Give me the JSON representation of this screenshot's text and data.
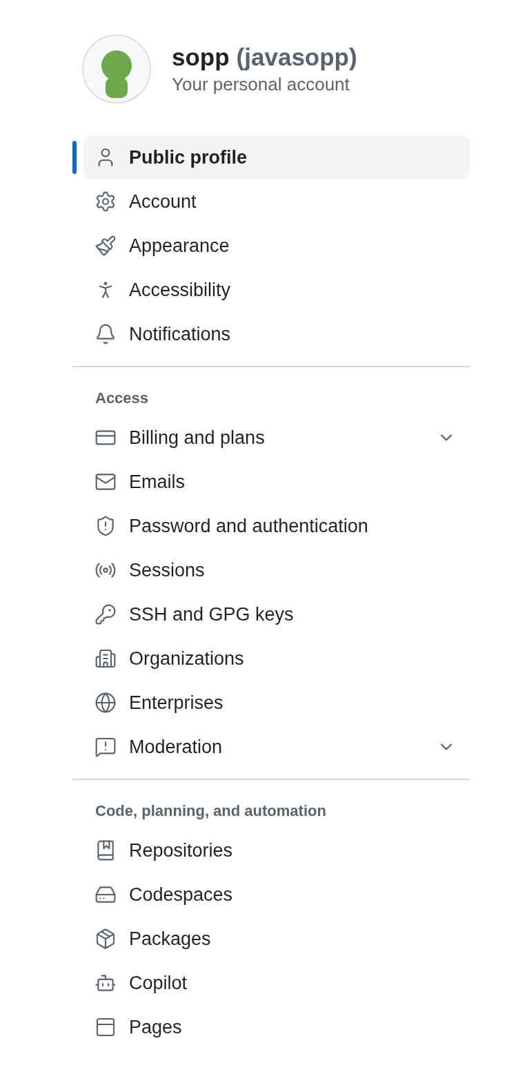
{
  "account": {
    "name": "sopp",
    "handle": "(javasopp)",
    "subtitle": "Your personal account"
  },
  "sections": [
    {
      "items": [
        {
          "label": "Public profile",
          "selected": true
        },
        {
          "label": "Account",
          "selected": false
        },
        {
          "label": "Appearance",
          "selected": false
        },
        {
          "label": "Accessibility",
          "selected": false
        },
        {
          "label": "Notifications",
          "selected": false
        }
      ]
    },
    {
      "heading": "Access",
      "items": [
        {
          "label": "Billing and plans",
          "selected": false,
          "expanded": false
        },
        {
          "label": "Emails",
          "selected": false
        },
        {
          "label": "Password and authentication",
          "selected": false
        },
        {
          "label": "Sessions",
          "selected": false
        },
        {
          "label": "SSH and GPG keys",
          "selected": false
        },
        {
          "label": "Organizations",
          "selected": false
        },
        {
          "label": "Enterprises",
          "selected": false
        },
        {
          "label": "Moderation",
          "selected": false,
          "expanded": false
        }
      ]
    },
    {
      "heading": "Code, planning, and automation",
      "items": [
        {
          "label": "Repositories",
          "selected": false
        },
        {
          "label": "Codespaces",
          "selected": false
        },
        {
          "label": "Packages",
          "selected": false
        },
        {
          "label": "Copilot",
          "selected": false
        },
        {
          "label": "Pages",
          "selected": false
        }
      ]
    }
  ]
}
